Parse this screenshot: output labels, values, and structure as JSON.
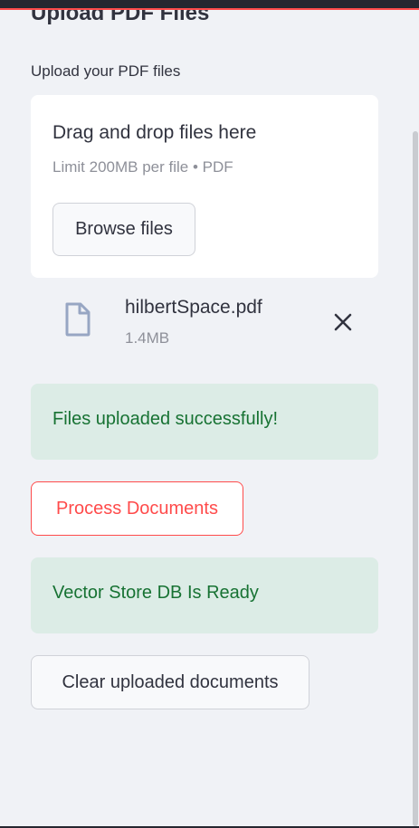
{
  "sidebar": {
    "section_title": "Upload PDF Files",
    "upload_label": "Upload your PDF files"
  },
  "dropzone": {
    "title": "Drag and drop files here",
    "limit": "Limit 200MB per file • PDF",
    "browse_label": "Browse files"
  },
  "uploaded_file": {
    "name": "hilbertSpace.pdf",
    "size": "1.4MB",
    "icon": "file-icon",
    "remove_icon": "close-icon"
  },
  "alerts": [
    {
      "text": "Files uploaded successfully!"
    },
    {
      "text": "Vector Store DB Is Ready"
    }
  ],
  "buttons": {
    "process": "Process Documents",
    "clear": "Clear uploaded documents"
  },
  "colors": {
    "accent": "#ff4b4b",
    "success_bg": "#dcece6",
    "success_text": "#177233",
    "background": "#f0f2f6"
  }
}
